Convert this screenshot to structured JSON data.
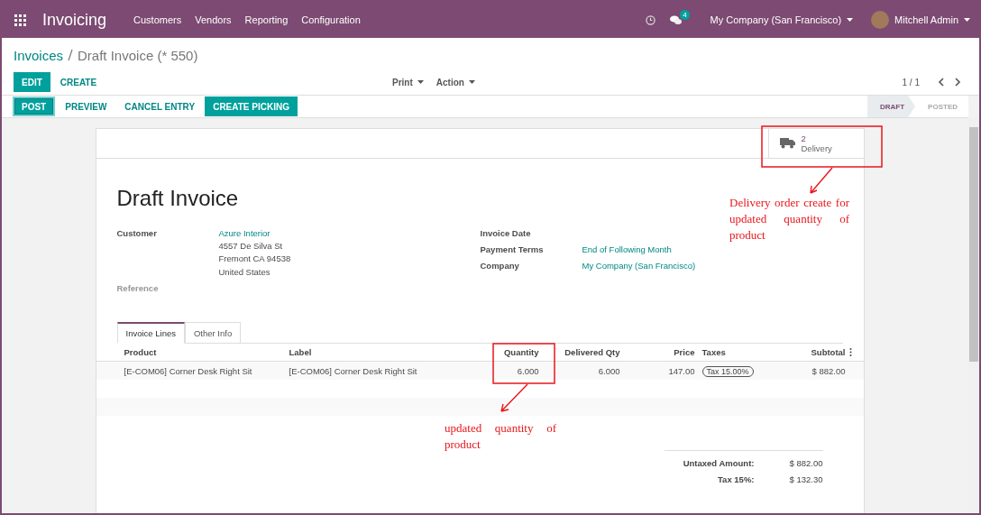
{
  "navbar": {
    "app_title": "Invoicing",
    "menu": [
      "Customers",
      "Vendors",
      "Reporting",
      "Configuration"
    ],
    "messages_count": "4",
    "company": "My Company (San Francisco)",
    "user": "Mitchell Admin"
  },
  "breadcrumb": [
    {
      "label": "Invoices",
      "kind": "link"
    },
    {
      "label": "Draft Invoice (* 550)",
      "kind": "current"
    }
  ],
  "control_buttons": [
    {
      "label": "EDIT",
      "kind": "primary"
    },
    {
      "label": "CREATE",
      "kind": "link"
    }
  ],
  "dropdowns": [
    "Print",
    "Action"
  ],
  "pager": "1 / 1",
  "header_buttons": [
    {
      "label": "POST",
      "kind": "focused"
    },
    {
      "label": "PREVIEW",
      "kind": "link"
    },
    {
      "label": "CANCEL ENTRY",
      "kind": "link"
    },
    {
      "label": "CREATE PICKING",
      "kind": "primary"
    }
  ],
  "stages": [
    {
      "label": "DRAFT",
      "selected": true
    },
    {
      "label": "POSTED",
      "selected": false
    }
  ],
  "smart_buttons": [
    {
      "count": "2",
      "label": "Delivery"
    }
  ],
  "title": "Draft Invoice",
  "left_fields": [
    {
      "label": "Customer",
      "kind": "link",
      "value": "Azure Interior",
      "address": [
        "4557 De Silva St",
        "Fremont CA 94538",
        "United States"
      ]
    },
    {
      "label": "Reference",
      "kind": "empty"
    }
  ],
  "right_fields": [
    {
      "label": "Invoice Date",
      "kind": "empty"
    },
    {
      "label": "Payment Terms",
      "kind": "link",
      "value": "End of Following Month"
    },
    {
      "label": "Company",
      "kind": "link",
      "value": "My Company (San Francisco)"
    }
  ],
  "tabs": [
    {
      "label": "Invoice Lines",
      "selected": true
    },
    {
      "label": "Other Info",
      "selected": false
    }
  ],
  "table": {
    "columns": [
      "Product",
      "Label",
      "Quantity",
      "Delivered Qty",
      "Price",
      "Taxes",
      "Subtotal"
    ],
    "rows": [
      {
        "product": "[E-COM06] Corner Desk Right Sit",
        "label": "[E-COM06] Corner Desk Right Sit",
        "quantity": "6.000",
        "delivered_qty": "6.000",
        "price": "147.00",
        "taxes": [
          "Tax 15.00%"
        ],
        "subtotal": "$ 882.00"
      }
    ]
  },
  "totals": [
    {
      "label": "Untaxed Amount:",
      "value": "$ 882.00"
    },
    {
      "label": "Tax 15%:",
      "value": "$ 132.30"
    }
  ],
  "annotations": [
    {
      "text": "Delivery order create for updated quantity of product"
    },
    {
      "text": "updated quantity of product"
    }
  ]
}
